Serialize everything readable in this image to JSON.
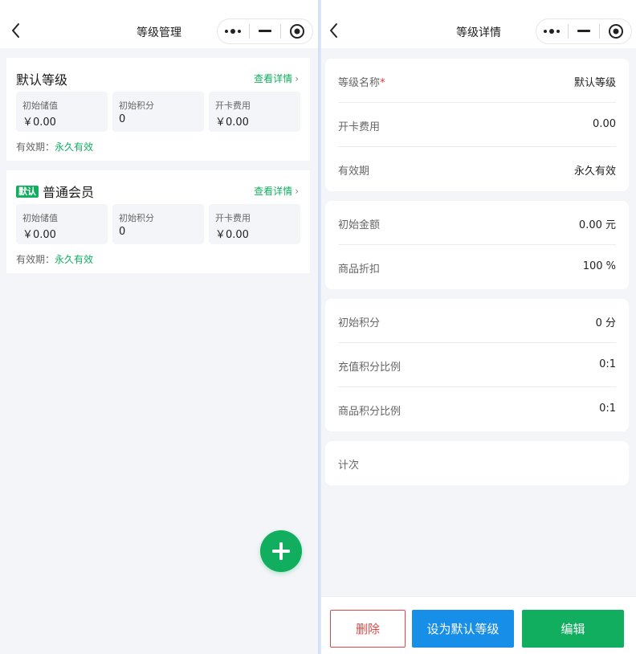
{
  "left": {
    "nav_title": "等级管理",
    "levels": [
      {
        "name": "默认等级",
        "is_default": false,
        "detail_label": "查看详情",
        "stats": [
          {
            "label": "初始储值",
            "value": "￥0.00"
          },
          {
            "label": "初始积分",
            "value": "0"
          },
          {
            "label": "开卡费用",
            "value": "￥0.00"
          }
        ],
        "validity_label": "有效期：",
        "validity_value": "永久有效"
      },
      {
        "name": "普通会员",
        "is_default": true,
        "badge": "默认",
        "detail_label": "查看详情",
        "stats": [
          {
            "label": "初始储值",
            "value": "￥0.00"
          },
          {
            "label": "初始积分",
            "value": "0"
          },
          {
            "label": "开卡费用",
            "value": "￥0.00"
          }
        ],
        "validity_label": "有效期：",
        "validity_value": "永久有效"
      }
    ]
  },
  "right": {
    "nav_title": "等级详情",
    "sections": [
      {
        "rows": [
          {
            "label": "等级名称",
            "required": "*",
            "value": "默认等级"
          },
          {
            "label": "开卡费用",
            "value": "0.00"
          },
          {
            "label": "有效期",
            "value": "永久有效"
          }
        ]
      },
      {
        "rows": [
          {
            "label": "初始金额",
            "value": "0.00 元"
          },
          {
            "label": "商品折扣",
            "value": "100 %"
          }
        ]
      },
      {
        "rows": [
          {
            "label": "初始积分",
            "value": "0 分"
          },
          {
            "label": "充值积分比例",
            "value": "0:1"
          },
          {
            "label": "商品积分比例",
            "value": "0:1"
          }
        ]
      },
      {
        "rows": [
          {
            "label": "计次",
            "value": ""
          }
        ]
      }
    ],
    "buttons": {
      "delete": "删除",
      "set_default": "设为默认等级",
      "edit": "编辑"
    }
  },
  "colors": {
    "accent_green": "#11ae5f",
    "accent_blue": "#178ee8",
    "danger_red": "#e04747"
  }
}
